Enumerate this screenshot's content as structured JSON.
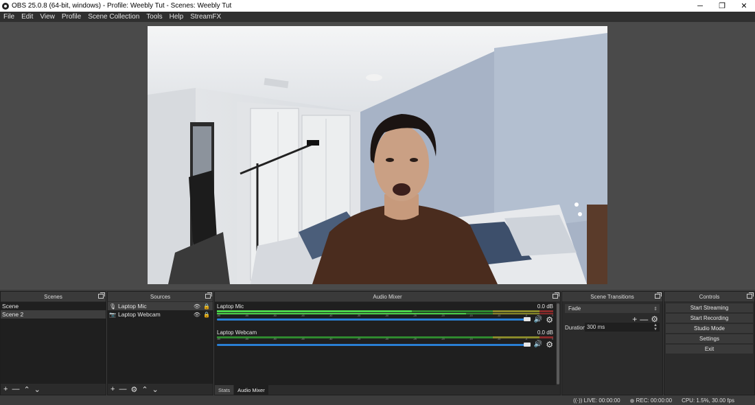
{
  "window": {
    "title": "OBS 25.0.8 (64-bit, windows) - Profile: Weebly Tut - Scenes: Weebly Tut",
    "minimize": "─",
    "restore": "❐",
    "close": "✕"
  },
  "menu": [
    "File",
    "Edit",
    "View",
    "Profile",
    "Scene Collection",
    "Tools",
    "Help",
    "StreamFX"
  ],
  "scenes": {
    "title": "Scenes",
    "items": [
      "Scene",
      "Scene 2"
    ],
    "selected_index": 1
  },
  "sources": {
    "title": "Sources",
    "items": [
      {
        "name": "Laptop Mic",
        "icon": "microphone-icon"
      },
      {
        "name": "Laptop Webcam",
        "icon": "camera-icon"
      }
    ]
  },
  "mixer": {
    "title": "Audio Mixer",
    "channels": [
      {
        "name": "Laptop Mic",
        "db": "0.0 dB"
      },
      {
        "name": "Laptop Webcam",
        "db": "0.0 dB"
      }
    ],
    "tick_labels": [
      "-60",
      "-55",
      "-50",
      "-45",
      "-40",
      "-35",
      "-30",
      "-25",
      "-20",
      "-15",
      "-10",
      "-5",
      "0"
    ],
    "tabs": [
      "Stats",
      "Audio Mixer"
    ],
    "active_tab": "Audio Mixer"
  },
  "transitions": {
    "title": "Scene Transitions",
    "selected": "Fade",
    "duration_label": "Duration",
    "duration_value": "300 ms"
  },
  "controls": {
    "title": "Controls",
    "buttons": [
      "Start Streaming",
      "Start Recording",
      "Studio Mode",
      "Settings",
      "Exit"
    ]
  },
  "status": {
    "live": "LIVE: 00:00:00",
    "rec": "REC: 00:00:00",
    "cpu": "CPU: 1.5%, 30.00 fps"
  },
  "colors": {
    "meter_green": "#2f8a2f",
    "meter_active": "#4cd64c",
    "slider_blue": "#2a7fd4"
  }
}
